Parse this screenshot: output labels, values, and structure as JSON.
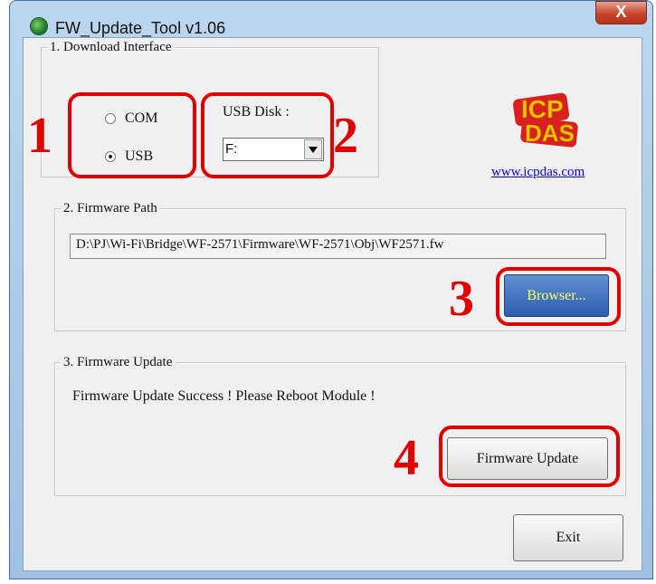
{
  "window": {
    "title": "FW_Update_Tool v1.06",
    "close_label": "X"
  },
  "download_interface": {
    "legend": "1. Download Interface",
    "options": [
      {
        "label": "COM",
        "checked": false
      },
      {
        "label": "USB",
        "checked": true
      }
    ],
    "usb_disk_label": "USB Disk :",
    "usb_disk_value": "F:"
  },
  "logo": {
    "name": "icpdas-logo",
    "text": "ICP DAS",
    "link": "www.icpdas.com"
  },
  "firmware_path": {
    "legend": "2. Firmware Path",
    "value": "D:\\PJ\\Wi-Fi\\Bridge\\WF-2571\\Firmware\\WF-2571\\Obj\\WF2571.fw",
    "browse_label": "Browser..."
  },
  "firmware_update": {
    "legend": "3. Firmware Update",
    "status": "Firmware Update Success !  Please Reboot Module !",
    "update_label": "Firmware Update"
  },
  "exit_label": "Exit",
  "annotations": {
    "steps": [
      "1",
      "2",
      "3",
      "4"
    ],
    "highlight_color": "#e00000"
  }
}
